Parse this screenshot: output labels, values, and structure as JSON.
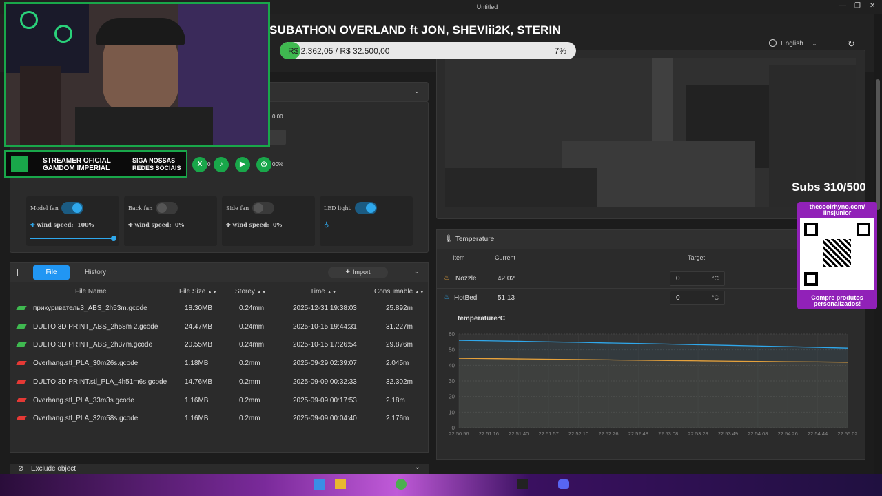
{
  "window": {
    "title": "Untitled",
    "minimize": "—",
    "maximize": "❐",
    "close": "✕"
  },
  "header": {
    "language": "English",
    "language_icon": "globe-icon",
    "refresh_icon": "refresh-icon"
  },
  "overlay": {
    "subathon_title": "SUBATHON OVERLAND ft JON, SHEVIii2K, STERIN",
    "goal_text": "R$ 2.362,05 / R$ 32.500,00",
    "goal_percent": "7%",
    "goal_fraction": 0.07,
    "banner_line1": "STREAMER OFICIAL",
    "banner_line2": "GAMDOM IMPERIAL",
    "banner_line3": "SIGA NOSSAS",
    "banner_line4": "REDES SOCIAIS",
    "subs": "Subs 310/500",
    "qr_url_line1": "thecoolrhyno.com/",
    "qr_url_line2": "linsjunior",
    "qr_caption_line1": "Compre produtos",
    "qr_caption_line2": "personalizados!"
  },
  "fans": [
    {
      "label": "Model fan",
      "on": true,
      "ws_label": "wind speed:",
      "ws_value": "100%",
      "slider": 1.0
    },
    {
      "label": "Back fan",
      "on": false,
      "ws_label": "wind speed:",
      "ws_value": "0%"
    },
    {
      "label": "Side fan",
      "on": false,
      "ws_label": "wind speed:",
      "ws_value": "0%"
    },
    {
      "label": "LED light",
      "on": true
    }
  ],
  "partial_values": {
    "v1": "0.00",
    "v2": "0",
    "v3": "00%"
  },
  "files": {
    "tab_file": "File",
    "tab_history": "History",
    "import": "Import",
    "columns": {
      "name": "File Name",
      "size": "File Size",
      "storey": "Storey",
      "time": "Time",
      "consumable": "Consumable"
    },
    "rows": [
      {
        "name": "прикуриватель3_ABS_2h53m.gcode",
        "size": "18.30MB",
        "storey": "0.24mm",
        "time": "2025-12-31 19:38:03",
        "consumable": "25.892m"
      },
      {
        "name": "DULTO 3D PRINT_ABS_2h58m 2.gcode",
        "size": "24.47MB",
        "storey": "0.24mm",
        "time": "2025-10-15 19:44:31",
        "consumable": "31.227m"
      },
      {
        "name": "DULTO 3D PRINT_ABS_2h37m.gcode",
        "size": "20.55MB",
        "storey": "0.24mm",
        "time": "2025-10-15 17:26:54",
        "consumable": "29.876m"
      },
      {
        "name": "Overhang.stl_PLA_30m26s.gcode",
        "size": "1.18MB",
        "storey": "0.2mm",
        "time": "2025-09-29 02:39:07",
        "consumable": "2.045m"
      },
      {
        "name": "DULTO 3D PRINT.stl_PLA_4h51m6s.gcode",
        "size": "14.76MB",
        "storey": "0.2mm",
        "time": "2025-09-09 00:32:33",
        "consumable": "32.302m"
      },
      {
        "name": "Overhang.stl_PLA_33m3s.gcode",
        "size": "1.16MB",
        "storey": "0.2mm",
        "time": "2025-09-09 00:17:53",
        "consumable": "2.18m"
      },
      {
        "name": "Overhang.stl_PLA_32m58s.gcode",
        "size": "1.16MB",
        "storey": "0.2mm",
        "time": "2025-09-09 00:04:40",
        "consumable": "2.176m"
      }
    ]
  },
  "exclude": {
    "label": "Exclude object"
  },
  "temperature": {
    "title": "Temperature",
    "col_item": "Item",
    "col_current": "Current",
    "col_target": "Target",
    "nozzle": {
      "label": "Nozzle",
      "current": "42.02",
      "target": "0",
      "unit": "°C"
    },
    "hotbed": {
      "label": "HotBed",
      "current": "51.13",
      "target": "0",
      "unit": "°C"
    }
  },
  "chart_data": {
    "type": "line",
    "title": "temperature°C",
    "x": [
      "22:50:56",
      "22:51:16",
      "22:51:40",
      "22:51:57",
      "22:52:10",
      "22:52:26",
      "22:52:48",
      "22:53:08",
      "22:53:28",
      "22:53:49",
      "22:54:08",
      "22:54:26",
      "22:54:44",
      "22:55:02"
    ],
    "ylim": [
      0,
      60
    ],
    "yticks": [
      0,
      10,
      20,
      30,
      40,
      50,
      60
    ],
    "series": [
      {
        "values": [
          56,
          55.7,
          55.4,
          55,
          54.7,
          54.3,
          54,
          53.6,
          53.2,
          52.8,
          52.4,
          52,
          51.6,
          51.1
        ],
        "color": "#2fa8ec"
      },
      {
        "values": [
          44.5,
          44.3,
          44.1,
          43.9,
          43.7,
          43.5,
          43.3,
          43.1,
          42.9,
          42.7,
          42.5,
          42.3,
          42.2,
          42
        ],
        "color": "#e6a23c"
      }
    ],
    "grid": true
  },
  "colors": {
    "accent": "#2196f3",
    "toggle_on": "#2fa8ec",
    "stream_green": "#19a74a",
    "qr_purple": "#9121b8"
  }
}
